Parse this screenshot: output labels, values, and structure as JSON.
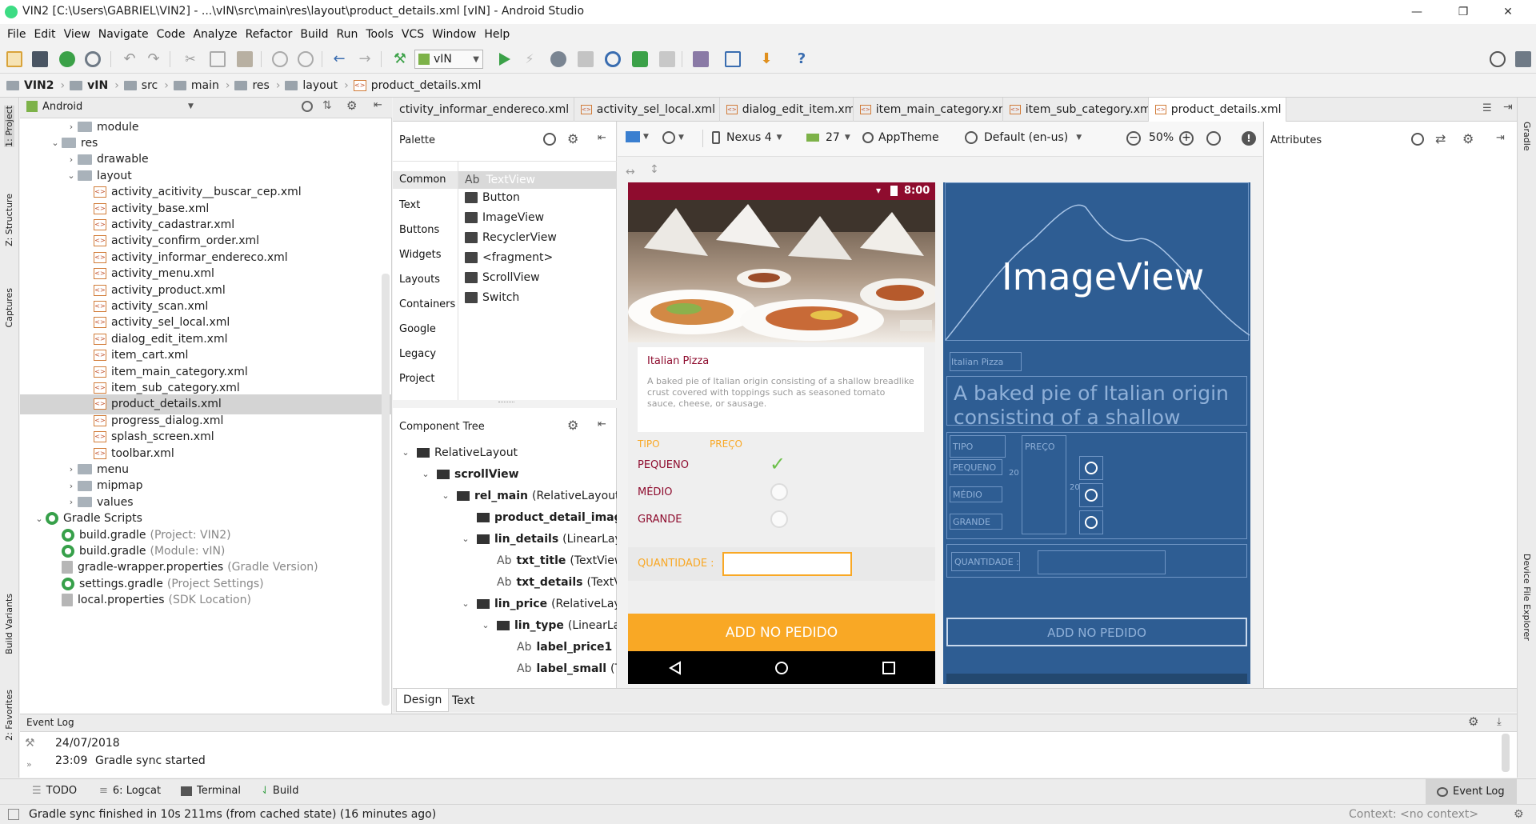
{
  "window": {
    "title": "VIN2 [C:\\Users\\GABRIEL\\VIN2] - ...\\vIN\\src\\main\\res\\layout\\product_details.xml [vIN] - Android Studio",
    "minimize": "—",
    "maximize": "❐",
    "close": "✕"
  },
  "menu": [
    "File",
    "Edit",
    "View",
    "Navigate",
    "Code",
    "Analyze",
    "Refactor",
    "Build",
    "Run",
    "Tools",
    "VCS",
    "Window",
    "Help"
  ],
  "toolbar": {
    "run_config": "vIN"
  },
  "breadcrumb": [
    "VIN2",
    "vIN",
    "src",
    "main",
    "res",
    "layout",
    "product_details.xml"
  ],
  "side_tabs": {
    "left": [
      "1: Project",
      "Z: Structure",
      "Captures",
      "Build Variants",
      "2: Favorites"
    ],
    "right": [
      "Gradle",
      "Device File Explorer"
    ]
  },
  "project": {
    "view": "Android",
    "rows": [
      {
        "label": "module",
        "indent": 3,
        "type": "folder",
        "arrow": "›"
      },
      {
        "label": "res",
        "indent": 2,
        "type": "folder",
        "arrow": "⌄"
      },
      {
        "label": "drawable",
        "indent": 3,
        "type": "folder",
        "arrow": "›"
      },
      {
        "label": "layout",
        "indent": 3,
        "type": "folder",
        "arrow": "⌄"
      },
      {
        "label": "activity_acitivity__buscar_cep.xml",
        "indent": 4,
        "type": "xml"
      },
      {
        "label": "activity_base.xml",
        "indent": 4,
        "type": "xml"
      },
      {
        "label": "activity_cadastrar.xml",
        "indent": 4,
        "type": "xml"
      },
      {
        "label": "activity_confirm_order.xml",
        "indent": 4,
        "type": "xml"
      },
      {
        "label": "activity_informar_endereco.xml",
        "indent": 4,
        "type": "xml"
      },
      {
        "label": "activity_menu.xml",
        "indent": 4,
        "type": "xml"
      },
      {
        "label": "activity_product.xml",
        "indent": 4,
        "type": "xml"
      },
      {
        "label": "activity_scan.xml",
        "indent": 4,
        "type": "xml"
      },
      {
        "label": "activity_sel_local.xml",
        "indent": 4,
        "type": "xml"
      },
      {
        "label": "dialog_edit_item.xml",
        "indent": 4,
        "type": "xml"
      },
      {
        "label": "item_cart.xml",
        "indent": 4,
        "type": "xml"
      },
      {
        "label": "item_main_category.xml",
        "indent": 4,
        "type": "xml"
      },
      {
        "label": "item_sub_category.xml",
        "indent": 4,
        "type": "xml"
      },
      {
        "label": "product_details.xml",
        "indent": 4,
        "type": "xml",
        "selected": true
      },
      {
        "label": "progress_dialog.xml",
        "indent": 4,
        "type": "xml"
      },
      {
        "label": "splash_screen.xml",
        "indent": 4,
        "type": "xml"
      },
      {
        "label": "toolbar.xml",
        "indent": 4,
        "type": "xml"
      },
      {
        "label": "menu",
        "indent": 3,
        "type": "folder",
        "arrow": "›"
      },
      {
        "label": "mipmap",
        "indent": 3,
        "type": "folder",
        "arrow": "›"
      },
      {
        "label": "values",
        "indent": 3,
        "type": "folder",
        "arrow": "›"
      },
      {
        "label": "Gradle Scripts",
        "indent": 1,
        "type": "gradle",
        "arrow": "⌄"
      },
      {
        "label": "build.gradle",
        "note": "(Project: VIN2)",
        "indent": 2,
        "type": "gradle"
      },
      {
        "label": "build.gradle",
        "note": "(Module: vIN)",
        "indent": 2,
        "type": "gradle"
      },
      {
        "label": "gradle-wrapper.properties",
        "note": "(Gradle Version)",
        "indent": 2,
        "type": "file"
      },
      {
        "label": "settings.gradle",
        "note": "(Project Settings)",
        "indent": 2,
        "type": "gradle"
      },
      {
        "label": "local.properties",
        "note": "(SDK Location)",
        "indent": 2,
        "type": "file"
      }
    ]
  },
  "editor_tabs": [
    {
      "label": "ctivity_informar_endereco.xml"
    },
    {
      "label": "activity_sel_local.xml"
    },
    {
      "label": "dialog_edit_item.xml"
    },
    {
      "label": "item_main_category.xml"
    },
    {
      "label": "item_sub_category.xml"
    },
    {
      "label": "product_details.xml",
      "active": true
    }
  ],
  "palette": {
    "title": "Palette",
    "categories": [
      "Common",
      "Text",
      "Buttons",
      "Widgets",
      "Layouts",
      "Containers",
      "Google",
      "Legacy",
      "Project"
    ],
    "items": [
      "TextView",
      "Button",
      "ImageView",
      "RecyclerView",
      "<fragment>",
      "ScrollView",
      "Switch"
    ],
    "first_prefix": "Ab"
  },
  "component_tree": {
    "title": "Component Tree",
    "rows": [
      {
        "name": "RelativeLayout",
        "type": "",
        "indent": 0,
        "arrow": "⌄",
        "bold": false
      },
      {
        "name": "scrollView",
        "type": "",
        "indent": 1,
        "arrow": "⌄",
        "bold": true
      },
      {
        "name": "rel_main",
        "type": "(RelativeLayout)",
        "indent": 2,
        "arrow": "⌄",
        "bold": true
      },
      {
        "name": "product_detail_image",
        "type": "",
        "indent": 3,
        "arrow": "",
        "bold": true
      },
      {
        "name": "lin_details",
        "type": "(LinearLayout)",
        "indent": 3,
        "arrow": "⌄",
        "bold": true
      },
      {
        "name": "txt_title",
        "type": "(TextView)",
        "indent": 4,
        "arrow": "",
        "bold": true,
        "prefix": "Ab"
      },
      {
        "name": "txt_details",
        "type": "(TextView)",
        "indent": 4,
        "arrow": "",
        "bold": true,
        "prefix": "Ab"
      },
      {
        "name": "lin_price",
        "type": "(RelativeLayout)",
        "indent": 3,
        "arrow": "⌄",
        "bold": true
      },
      {
        "name": "lin_type",
        "type": "(LinearLayout)",
        "indent": 4,
        "arrow": "⌄",
        "bold": true
      },
      {
        "name": "label_price1",
        "type": "(TextView)",
        "indent": 5,
        "arrow": "",
        "bold": true,
        "prefix": "Ab"
      },
      {
        "name": "label_small",
        "type": "(TextView)",
        "indent": 5,
        "arrow": "",
        "bold": true,
        "prefix": "Ab"
      }
    ]
  },
  "design_toolbar": {
    "device": "Nexus 4",
    "api": "27",
    "theme": "AppTheme",
    "locale": "Default (en-us)",
    "zoom": "50%"
  },
  "attributes": {
    "title": "Attributes"
  },
  "phone": {
    "time": "8:00",
    "title": "Italian Pizza",
    "description": "A baked pie of Italian origin consisting of a shallow breadlike crust covered with toppings such as seasoned tomato sauce, cheese, or sausage.",
    "col_type": "TIPO",
    "col_price": "PREÇO",
    "sizes": [
      "PEQUENO",
      "MÉDIO",
      "GRANDE"
    ],
    "selected_size": 0,
    "quantity_label": "QUANTIDADE :",
    "add_button": "ADD NO PEDIDO"
  },
  "blueprint": {
    "image_label": "ImageView",
    "title": "Italian Pizza",
    "desc_line1": "A baked pie of Italian origin",
    "desc_line2": "consisting of a shallow",
    "col_type": "TIPO",
    "col_price": "PREÇO",
    "sizes": [
      "PEQUENO",
      "MÉDIO",
      "GRANDE"
    ],
    "margin": "20",
    "quantity_label": "QUANTIDADE :",
    "add_button": "ADD NO PEDIDO"
  },
  "design_tabs": [
    "Design",
    "Text"
  ],
  "event_log": {
    "title": "Event Log",
    "date": "24/07/2018",
    "time": "23:09",
    "message": "Gradle sync started"
  },
  "bottom_tools": [
    "TODO",
    "6: Logcat",
    "Terminal",
    "Build",
    "Event Log"
  ],
  "status": {
    "message": "Gradle sync finished in 10s 211ms (from cached state) (16 minutes ago)",
    "context": "Context: <no context>"
  },
  "colors": {
    "brand_red": "#8e0c2e",
    "accent_orange": "#f9a825",
    "check_green": "#6cc04a",
    "blueprint": "#2e5d93"
  }
}
